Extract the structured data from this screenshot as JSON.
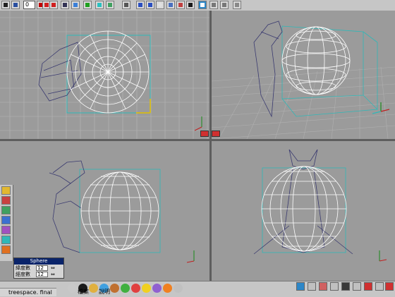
{
  "toolbar": {
    "frame_value": "0",
    "icons": [
      "file-icon",
      "save-icon",
      "frame-field",
      "stop-icon",
      "play-back-icon",
      "play-icon",
      "step-icon",
      "grid-icon",
      "layers-icon",
      "render-icon",
      "light-icon",
      "camera-icon",
      "morph-icon",
      "motion-icon",
      "object-icon",
      "sphere-icon",
      "move-icon",
      "rotate-icon",
      "scale-icon",
      "view-4-icon",
      "up-arrow-icon",
      "down-arrow-icon",
      "door-icon"
    ]
  },
  "panel": {
    "title": "Sphere",
    "rows": [
      {
        "label": "緯度數",
        "value": "12"
      },
      {
        "label": "經度數",
        "value": "12"
      }
    ]
  },
  "status": {
    "filename": "treespace. final"
  },
  "menu": {
    "file": "檔案",
    "help": "說明"
  },
  "colors": {
    "viewport": "#9b9b9b",
    "wire": "#ffffff",
    "teal": "#2fb8b8",
    "toolbar": "#c6c6c6"
  }
}
